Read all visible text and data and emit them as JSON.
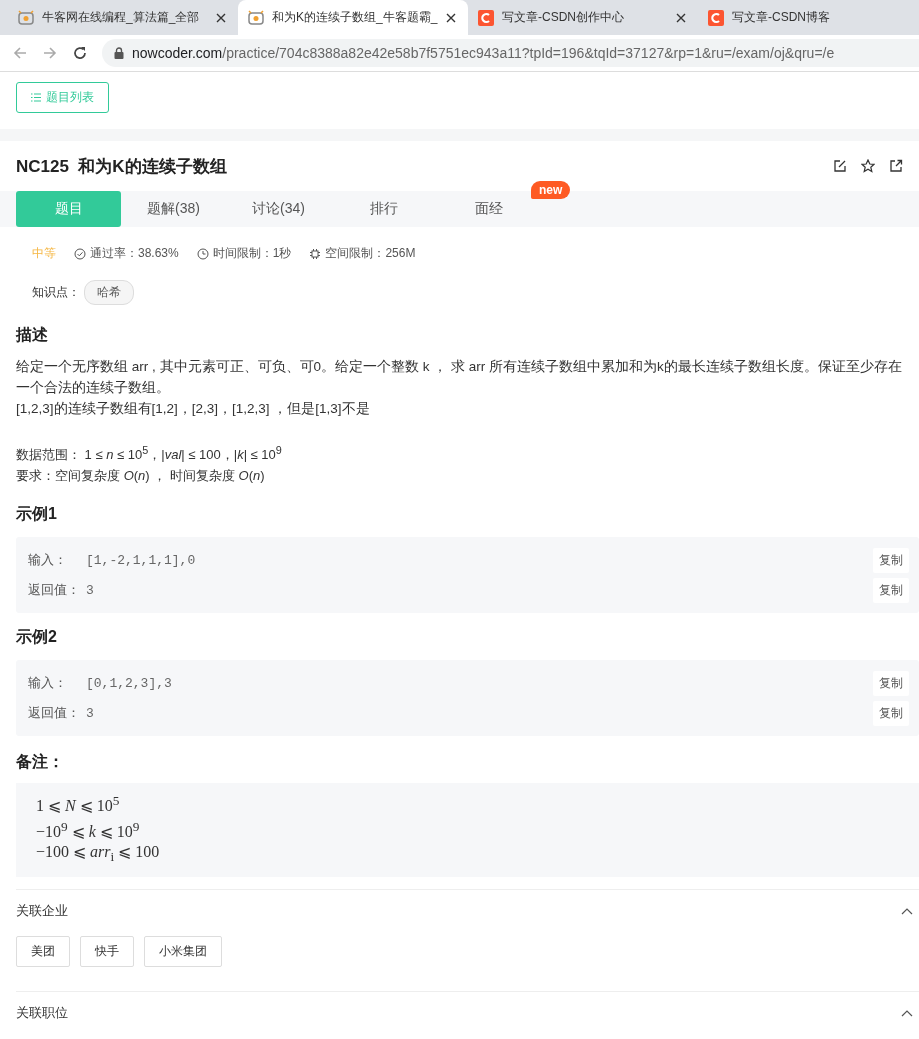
{
  "browser": {
    "tabs": [
      {
        "kind": "nowcoder",
        "title": "牛客网在线编程_算法篇_全部",
        "selected": false,
        "closable": true
      },
      {
        "kind": "nowcoder",
        "title": "和为K的连续子数组_牛客题霸_",
        "selected": true,
        "closable": true
      },
      {
        "kind": "csdn",
        "title": "写文章-CSDN创作中心",
        "selected": false,
        "closable": true
      },
      {
        "kind": "csdn",
        "title": "写文章-CSDN博客",
        "selected": false,
        "closable": false
      }
    ],
    "url_domain": "nowcoder.com",
    "url_path": "/practice/704c8388a82e42e58b7f5751ec943a11?tpId=196&tqId=37127&rp=1&ru=/exam/oj&qru=/e"
  },
  "list_button": "题目列表",
  "problem": {
    "title": "NC125  和为K的连续子数组",
    "tabs": [
      {
        "label": "题目",
        "selected": true
      },
      {
        "label": "题解(38)",
        "selected": false
      },
      {
        "label": "讨论(34)",
        "selected": false
      },
      {
        "label": "排行",
        "selected": false
      },
      {
        "label": "面经",
        "selected": false,
        "badge": "new"
      }
    ],
    "difficulty": "中等",
    "stats": [
      {
        "kind": "pass",
        "text": "通过率：38.63%"
      },
      {
        "kind": "time",
        "text": "时间限制：1秒"
      },
      {
        "kind": "memory",
        "text": "空间限制：256M"
      }
    ],
    "knowledge_label": "知识点：",
    "knowledge_tags": [
      "哈希"
    ]
  },
  "description": {
    "heading": "描述",
    "paragraphs": [
      "给定一个无序数组 arr , 其中元素可正、可负、可0。给定一个整数 k ， 求 arr 所有连续子数组中累加和为k的最长连续子数组长度。保证至少存在一个合法的连续子数组。",
      "[1,2,3]的连续子数组有[1,2]，[2,3]，[1,2,3] ，但是[1,3]不是"
    ],
    "constraints": [
      "数据范围： 1 ≤ *n* ≤ 10$^{5}$，|*val*| ≤ 100，|*k*| ≤ 10$^{9}$",
      "要求：空间复杂度 *O*(*n*) ， 时间复杂度 *O*(*n*)"
    ]
  },
  "examples": [
    {
      "heading": "示例1",
      "rows": [
        {
          "label": "输入：",
          "value": "[1,-2,1,1,1],0",
          "copy": "复制"
        },
        {
          "label": "返回值：",
          "value": "3",
          "copy": "复制"
        }
      ]
    },
    {
      "heading": "示例2",
      "rows": [
        {
          "label": "输入：",
          "value": "[0,1,2,3],3",
          "copy": "复制"
        },
        {
          "label": "返回值：",
          "value": "3",
          "copy": "复制"
        }
      ]
    }
  ],
  "notes": {
    "heading": "备注：",
    "lines": [
      "1 ⩽ *N* ⩽ 10$^{5}$",
      "−10$^{9}$ ⩽ *k* ⩽ 10$^{9}$",
      "−100 ⩽ *arr*$_{i}$ ⩽ 100"
    ]
  },
  "related": [
    {
      "title": "关联企业",
      "expanded": true,
      "tags": [
        "美团",
        "快手",
        "小米集团"
      ]
    },
    {
      "title": "关联职位",
      "expanded": true
    }
  ]
}
